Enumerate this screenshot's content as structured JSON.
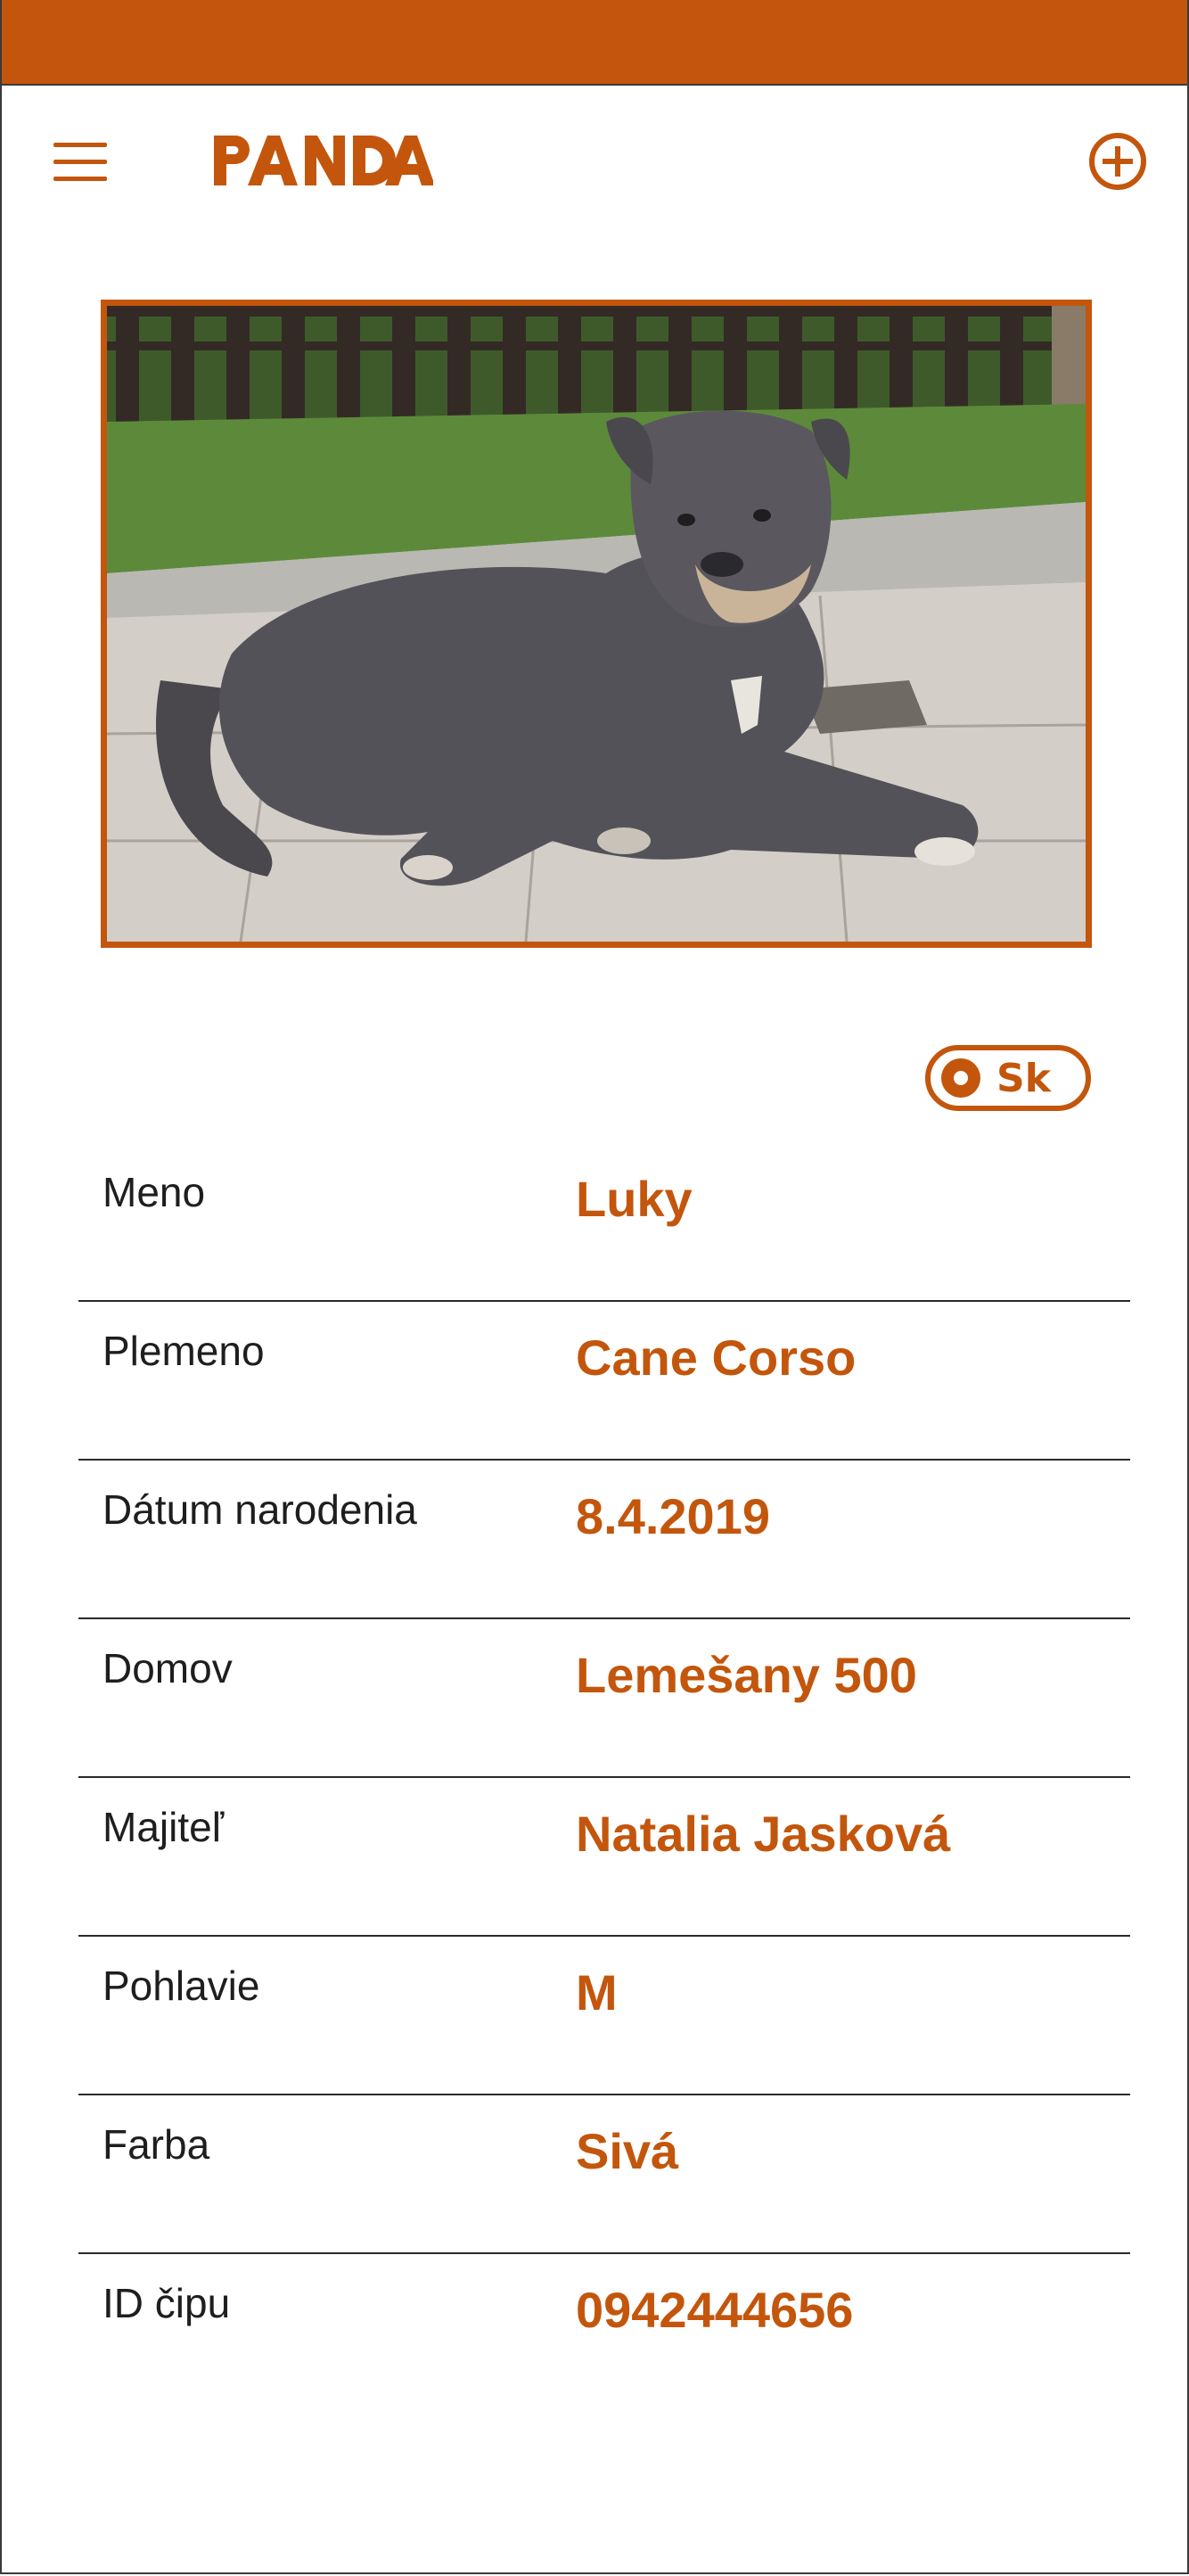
{
  "app": {
    "logo_text": "PANDA",
    "accent_color": "#c3560c"
  },
  "header": {
    "menu_icon": "hamburger-menu-icon",
    "add_icon": "plus-circle-icon"
  },
  "photo": {
    "subject": "dog-photo"
  },
  "language_toggle": {
    "label": "Sk"
  },
  "details": {
    "rows": [
      {
        "label": "Meno",
        "value": "Luky"
      },
      {
        "label": "Plemeno",
        "value": "Cane Corso"
      },
      {
        "label": "Dátum narodenia",
        "value": "8.4.2019"
      },
      {
        "label": "Domov",
        "value": "Lemešany 500"
      },
      {
        "label": "Majiteľ",
        "value": "Natalia Jasková"
      },
      {
        "label": "Pohlavie",
        "value": "M"
      },
      {
        "label": "Farba",
        "value": "Sivá"
      },
      {
        "label": "ID čipu",
        "value": "0942444656"
      }
    ]
  }
}
